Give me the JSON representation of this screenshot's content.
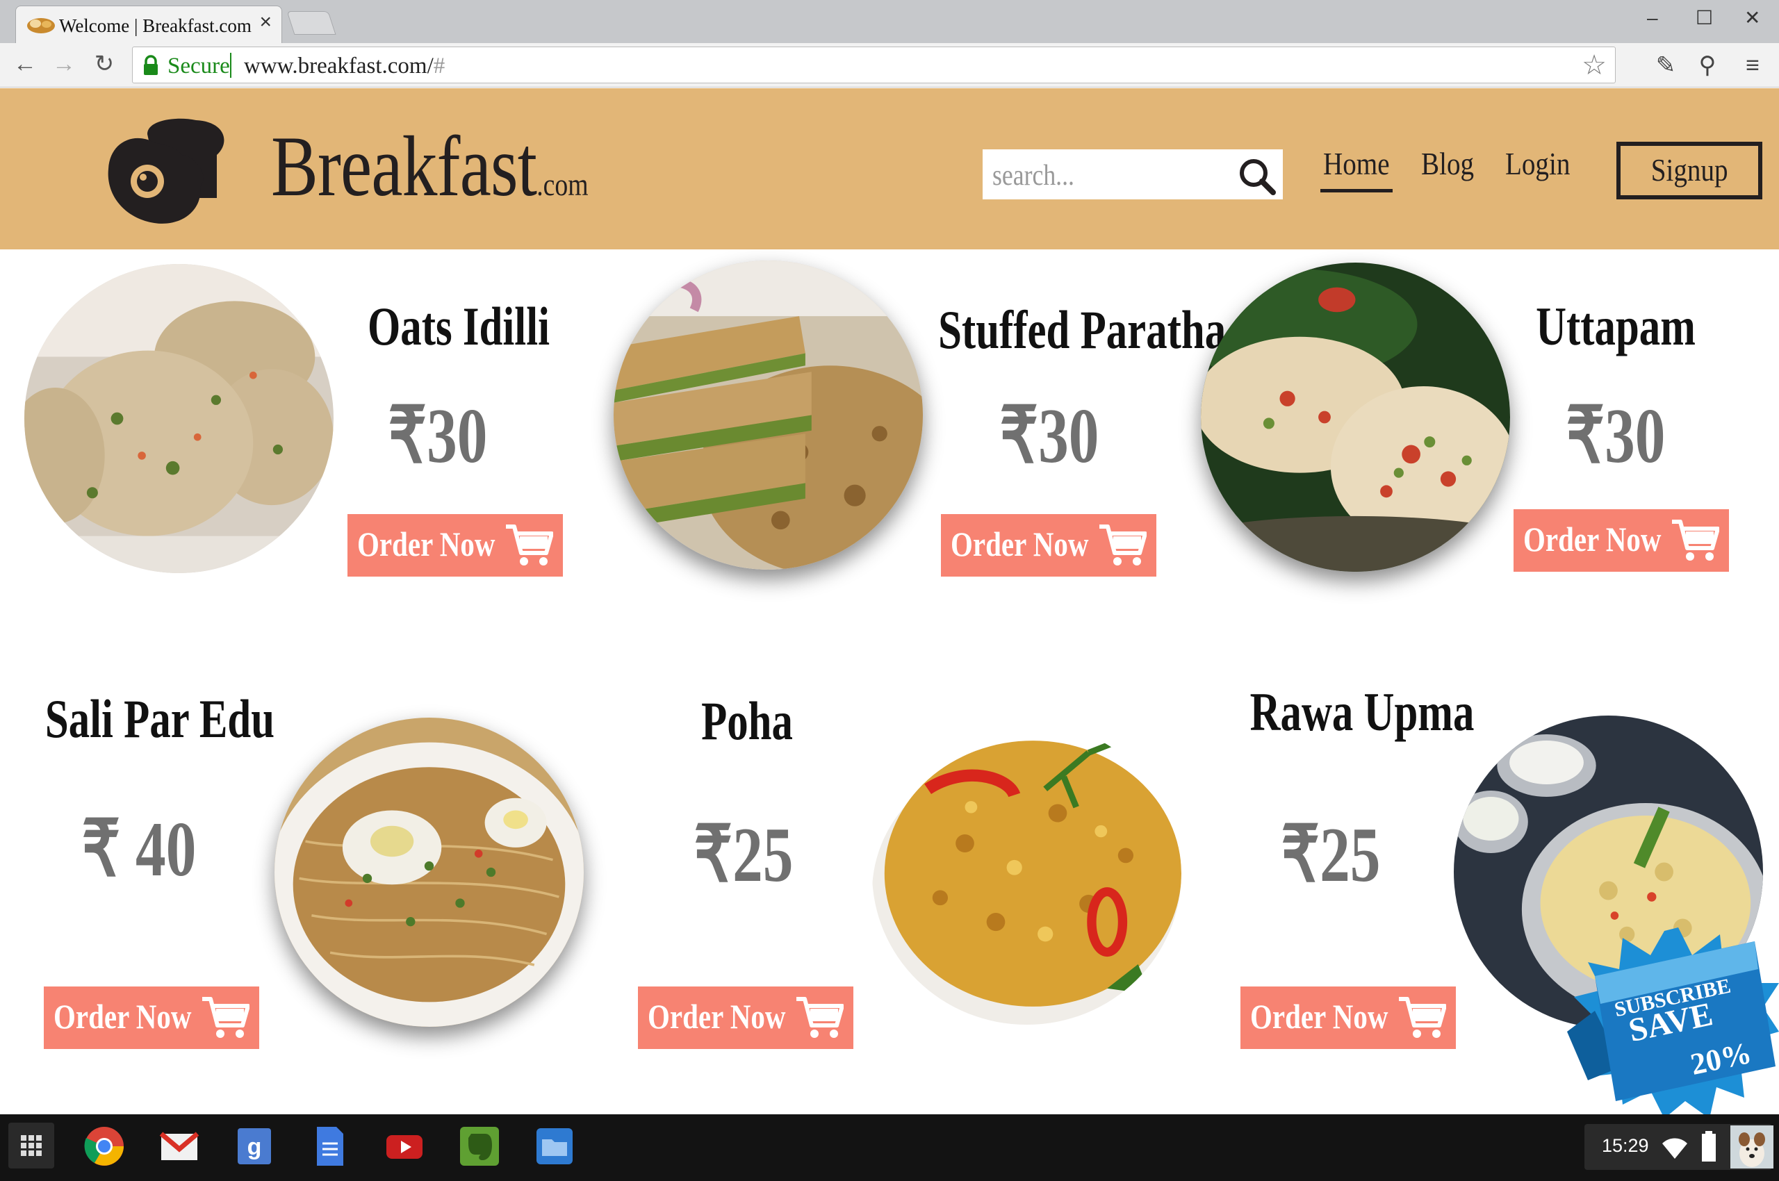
{
  "browser": {
    "tab_title": "Welcome | Breakfast.com",
    "secure_label": "Secure",
    "url_main": "www.breakfast.com/",
    "url_hash": "#"
  },
  "site": {
    "brand": "Breakfast",
    "brand_suffix": ".com",
    "search_placeholder": "search...",
    "nav": {
      "home": "Home",
      "blog": "Blog",
      "login": "Login",
      "signup": "Signup"
    },
    "accent_color": "#e2b677",
    "button_color": "#f78372"
  },
  "products": [
    {
      "name": "Oats Idilli",
      "price": "₹30",
      "order_label": "Order Now"
    },
    {
      "name": "Stuffed Paratha",
      "price": "₹30",
      "order_label": "Order Now"
    },
    {
      "name": "Uttapam",
      "price": "₹30",
      "order_label": "Order Now"
    },
    {
      "name": "Sali Par Edu",
      "price": "₹ 40",
      "order_label": "Order Now"
    },
    {
      "name": "Poha",
      "price": "₹25",
      "order_label": "Order Now"
    },
    {
      "name": "Rawa Upma",
      "price": "₹25",
      "order_label": "Order Now"
    }
  ],
  "promo": {
    "line1": "SUBSCRIBE",
    "line2": "SAVE",
    "discount": "20%"
  },
  "shelf": {
    "clock": "15:29",
    "apps": [
      "launcher-icon",
      "chrome-icon",
      "gmail-icon",
      "google-search-icon",
      "docs-icon",
      "youtube-icon",
      "evernote-icon",
      "files-icon"
    ]
  }
}
